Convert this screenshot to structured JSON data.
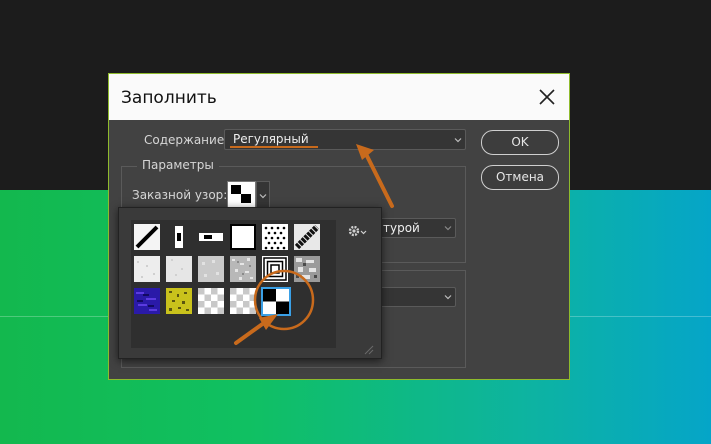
{
  "dialog": {
    "title": "Заполнить",
    "content_label": "Содержание:",
    "content_value": "Регулярный",
    "params_label": "Параметры",
    "custom_pattern_label": "Заказной узор:",
    "script_fragment": "турой",
    "ok_label": "OK",
    "cancel_label": "Отмена"
  },
  "pattern_picker": {
    "selected_pattern": "black-white-checkerboard",
    "patterns": [
      "diagonal-line",
      "vertical-line",
      "horizontal-line",
      "white-square",
      "dots",
      "diagonal-steps",
      "white-noise-1",
      "white-noise-2",
      "gray-noise",
      "gray-texture",
      "concentric-squares",
      "rock-texture",
      "blue-texture",
      "yellow-texture",
      "transparent-1",
      "transparent-2",
      "black-white-checkerboard"
    ]
  },
  "colors": {
    "dialog_bg": "#424242",
    "dialog_border": "#8fbb2d",
    "annotation": "#c86a1c",
    "selection": "#3aa0e6"
  }
}
